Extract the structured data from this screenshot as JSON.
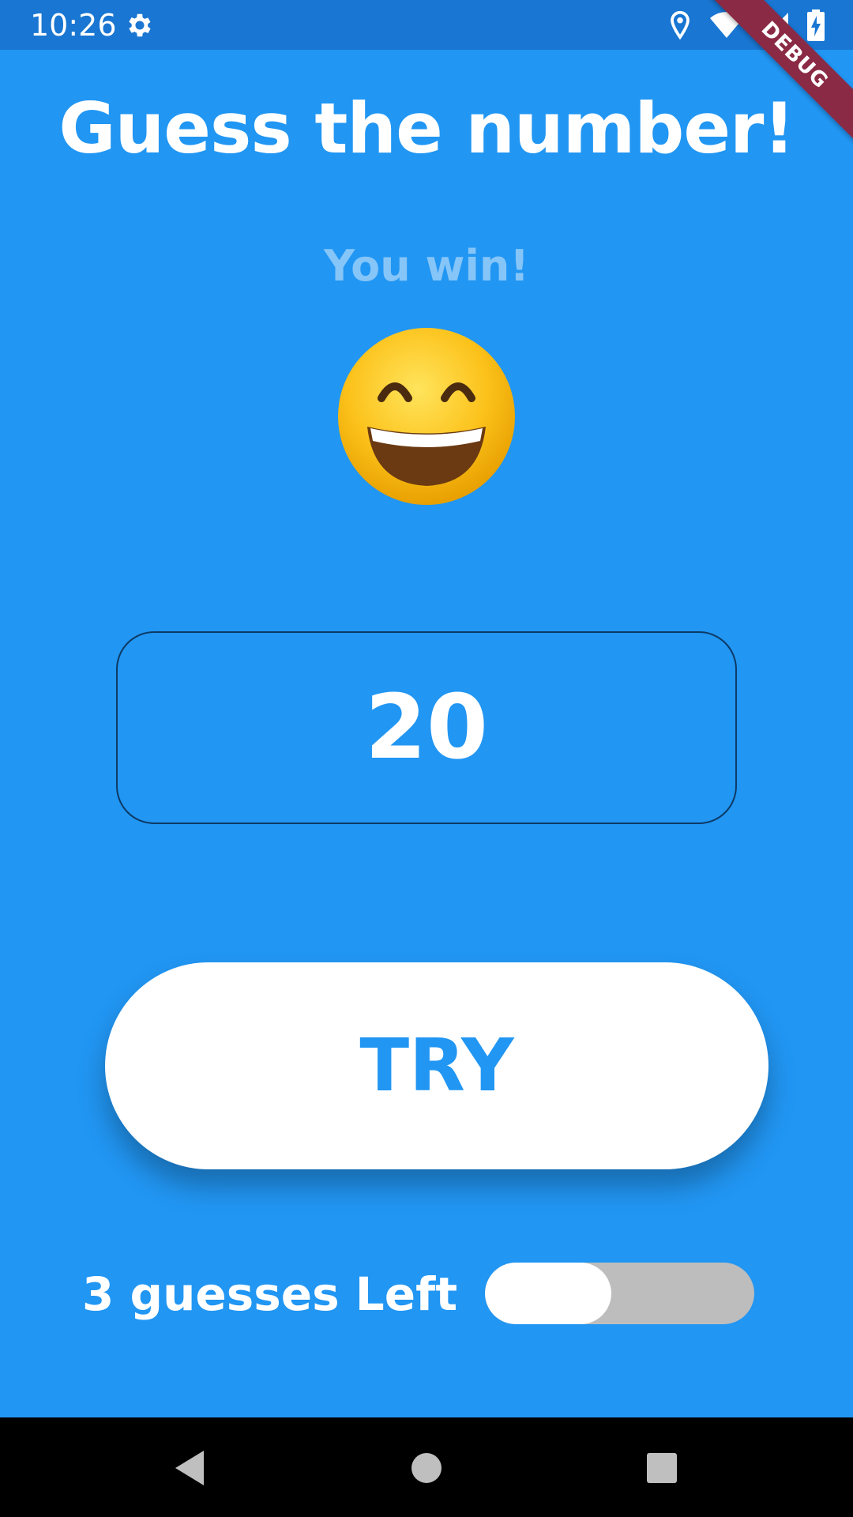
{
  "status_bar": {
    "time": "10:26",
    "icons": [
      "gear-icon",
      "location-icon",
      "wifi-icon",
      "signal-icon",
      "battery-charging-icon"
    ]
  },
  "debug_banner": "DEBUG",
  "title": "Guess the number!",
  "result": {
    "text": "You win!",
    "emoji": "grinning-face-with-smiling-eyes"
  },
  "number_field": {
    "value": "20"
  },
  "try_button": {
    "label": "TRY"
  },
  "guesses": {
    "label": "3 guesses Left",
    "remaining_fraction": 0.47
  },
  "navigation": {
    "icons": [
      "back-icon",
      "home-icon",
      "recents-icon"
    ]
  },
  "colors": {
    "background": "#2196f3",
    "status_bar": "#1976d2",
    "button": "#ffffff",
    "button_text": "#2196f3",
    "progress_track": "#bdbdbd",
    "progress_fill": "#ffffff",
    "debug_banner": "#8b2a44"
  }
}
